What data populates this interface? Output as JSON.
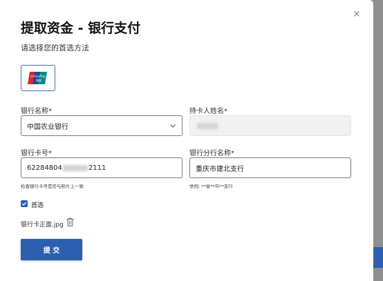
{
  "modal": {
    "title": "提取资金 - 银行支付",
    "subtitle": "请选择您的首选方法"
  },
  "payment_method": {
    "logo_text_top": "UnionPay",
    "logo_text_bottom": "银联"
  },
  "form": {
    "bank_name": {
      "label": "银行名称*",
      "value": "中国农业银行"
    },
    "holder_name": {
      "label": "持卡人姓名*",
      "value": ""
    },
    "card_number": {
      "label": "银行卡号*",
      "value_prefix": "62284804",
      "value_suffix": "2111",
      "hint": "检查银行卡号是否与照片上一致"
    },
    "branch_name": {
      "label": "银行分行名称*",
      "value": "重庆市建北支行",
      "hint": "举例: **省**市**支行"
    },
    "preferred": {
      "label": "首选",
      "checked": true
    },
    "attachment": {
      "file_name": "银行卡正面.jpg"
    },
    "submit_label": "提 交"
  },
  "colors": {
    "accent": "#2c5fb0",
    "overlay": "#9a9a9a"
  }
}
